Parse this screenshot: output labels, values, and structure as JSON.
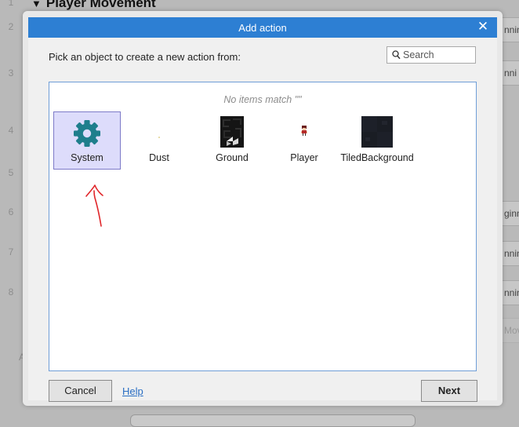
{
  "background": {
    "section_title": "Player Movement",
    "line_numbers": [
      "1",
      "2",
      "3",
      "4",
      "5",
      "6",
      "7",
      "8"
    ],
    "side_fragments": [
      "nnin",
      "nni",
      "ginn",
      "nnin",
      "nnin",
      "Mov"
    ],
    "left_fragment": "A"
  },
  "dialog": {
    "title": "Add action",
    "close_glyph": "✕",
    "instruction": "Pick an object to create a new action from:",
    "search": {
      "placeholder": "Search",
      "value": ""
    },
    "empty_message": "No items match \"\"",
    "objects": [
      {
        "label": "System",
        "icon": "gear-icon",
        "selected": true
      },
      {
        "label": "Dust",
        "icon": "dust-sprite",
        "selected": false
      },
      {
        "label": "Ground",
        "icon": "ground-tile",
        "selected": false
      },
      {
        "label": "Player",
        "icon": "player-sprite",
        "selected": false
      },
      {
        "label": "TiledBackground",
        "icon": "tiled-background-texture",
        "selected": false
      }
    ],
    "buttons": {
      "cancel": "Cancel",
      "help": "Help",
      "next": "Next"
    }
  },
  "colors": {
    "titlebar": "#2d7fd3",
    "selection": "#dddcfb",
    "gear": "#1e7e8c",
    "annotation": "#e0262a",
    "link": "#2a6fc4"
  }
}
